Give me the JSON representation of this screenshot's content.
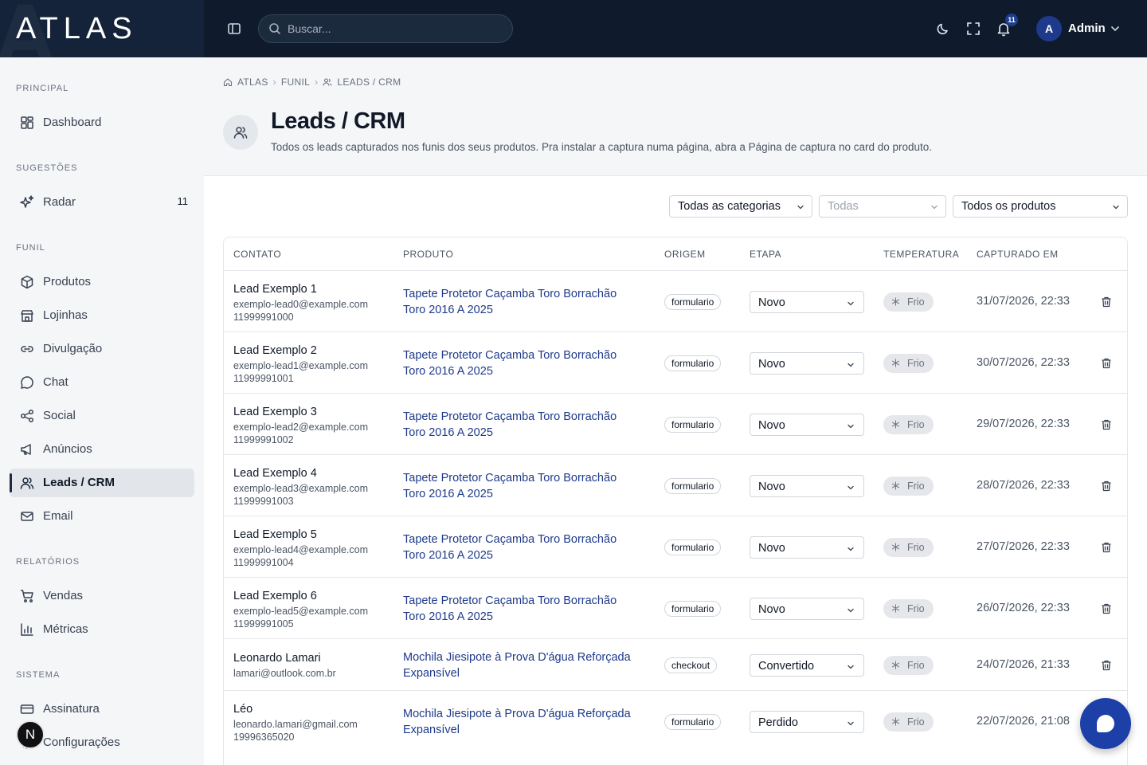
{
  "app": {
    "logo": "ATLAS"
  },
  "topbar": {
    "search_placeholder": "Buscar...",
    "notifications_count": "11",
    "user_initial": "A",
    "user_name": "Admin"
  },
  "sidebar": {
    "sections": {
      "principal": "PRINCIPAL",
      "sugestoes": "SUGESTÕES",
      "funil": "FUNIL",
      "relatorios": "RELATÓRIOS",
      "sistema": "SISTEMA"
    },
    "items": {
      "dashboard": "Dashboard",
      "radar": "Radar",
      "radar_count": "11",
      "produtos": "Produtos",
      "lojinhas": "Lojinhas",
      "divulgacao": "Divulgação",
      "chat": "Chat",
      "social": "Social",
      "anuncios": "Anúncios",
      "leads": "Leads / CRM",
      "email": "Email",
      "vendas": "Vendas",
      "metricas": "Métricas",
      "assinatura": "Assinatura",
      "configuracoes": "Configurações"
    },
    "n_badge": "N"
  },
  "breadcrumb": {
    "root": "ATLAS",
    "mid": "FUNIL",
    "current": "LEADS / CRM"
  },
  "page": {
    "title": "Leads / CRM",
    "subtitle": "Todos os leads capturados nos funis dos seus produtos. Pra instalar a captura numa página, abra a Página de captura no card do produto."
  },
  "filters": {
    "categories": "Todas as categorias",
    "sub": "Todas",
    "products": "Todos os produtos"
  },
  "table": {
    "headers": {
      "contato": "CONTATO",
      "produto": "PRODUTO",
      "origem": "ORIGEM",
      "etapa": "ETAPA",
      "temperatura": "TEMPERATURA",
      "capturado": "CAPTURADO EM"
    },
    "rows": [
      {
        "name": "Lead Exemplo 1",
        "email": "exemplo-lead0@example.com",
        "phone": "11999991000",
        "product1": "Tapete Protetor Caçamba Toro Borrachão",
        "product2": "Toro 2016 A 2025",
        "origin": "formulario",
        "stage": "Novo",
        "temp": "Frio",
        "date": "31/07/2026, 22:33"
      },
      {
        "name": "Lead Exemplo 2",
        "email": "exemplo-lead1@example.com",
        "phone": "11999991001",
        "product1": "Tapete Protetor Caçamba Toro Borrachão",
        "product2": "Toro 2016 A 2025",
        "origin": "formulario",
        "stage": "Novo",
        "temp": "Frio",
        "date": "30/07/2026, 22:33"
      },
      {
        "name": "Lead Exemplo 3",
        "email": "exemplo-lead2@example.com",
        "phone": "11999991002",
        "product1": "Tapete Protetor Caçamba Toro Borrachão",
        "product2": "Toro 2016 A 2025",
        "origin": "formulario",
        "stage": "Novo",
        "temp": "Frio",
        "date": "29/07/2026, 22:33"
      },
      {
        "name": "Lead Exemplo 4",
        "email": "exemplo-lead3@example.com",
        "phone": "11999991003",
        "product1": "Tapete Protetor Caçamba Toro Borrachão",
        "product2": "Toro 2016 A 2025",
        "origin": "formulario",
        "stage": "Novo",
        "temp": "Frio",
        "date": "28/07/2026, 22:33"
      },
      {
        "name": "Lead Exemplo 5",
        "email": "exemplo-lead4@example.com",
        "phone": "11999991004",
        "product1": "Tapete Protetor Caçamba Toro Borrachão",
        "product2": "Toro 2016 A 2025",
        "origin": "formulario",
        "stage": "Novo",
        "temp": "Frio",
        "date": "27/07/2026, 22:33"
      },
      {
        "name": "Lead Exemplo 6",
        "email": "exemplo-lead5@example.com",
        "phone": "11999991005",
        "product1": "Tapete Protetor Caçamba Toro Borrachão",
        "product2": "Toro 2016 A 2025",
        "origin": "formulario",
        "stage": "Novo",
        "temp": "Frio",
        "date": "26/07/2026, 22:33"
      },
      {
        "name": "Leonardo Lamari",
        "email": "lamari@outlook.com.br",
        "phone": "",
        "product1": "Mochila Jiesipote à Prova D'água Reforçada",
        "product2": "Expansível",
        "origin": "checkout",
        "stage": "Convertido",
        "temp": "Frio",
        "date": "24/07/2026, 21:33"
      },
      {
        "name": "Léo",
        "email": "leonardo.lamari@gmail.com",
        "phone": "19996365020",
        "product1": "Mochila Jiesipote à Prova D'água Reforçada",
        "product2": "Expansível",
        "origin": "formulario",
        "stage": "Perdido",
        "temp": "Frio",
        "date": "22/07/2026, 21:08"
      }
    ]
  },
  "colors": {
    "topbar": "#0f1b2d",
    "accent": "#1e3a8a",
    "fab": "#1d3fa8"
  }
}
